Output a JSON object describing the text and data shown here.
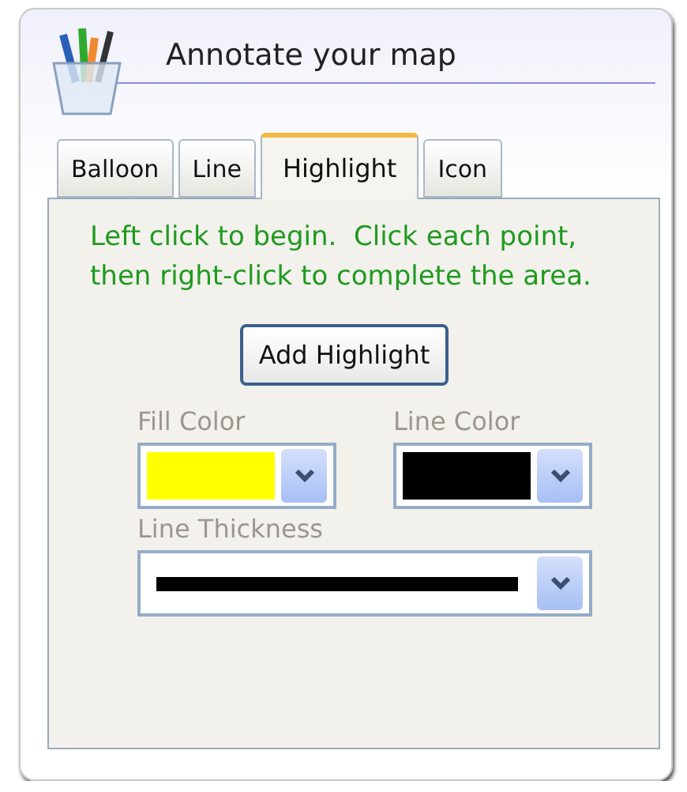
{
  "panel": {
    "title": "Annotate your map"
  },
  "tabs": [
    {
      "label": "Balloon",
      "selected": false
    },
    {
      "label": "Line",
      "selected": false
    },
    {
      "label": "Highlight",
      "selected": true
    },
    {
      "label": "Icon",
      "selected": false
    }
  ],
  "instructions": "Left click to begin.  Click each point, then right-click to complete the area.",
  "add_button": "Add Highlight",
  "color_pickers": [
    {
      "label": "Fill Color",
      "color": "#ffff00"
    },
    {
      "label": "Line Color",
      "color": "#000000"
    }
  ],
  "line_thickness": {
    "label": "Line Thickness"
  }
}
